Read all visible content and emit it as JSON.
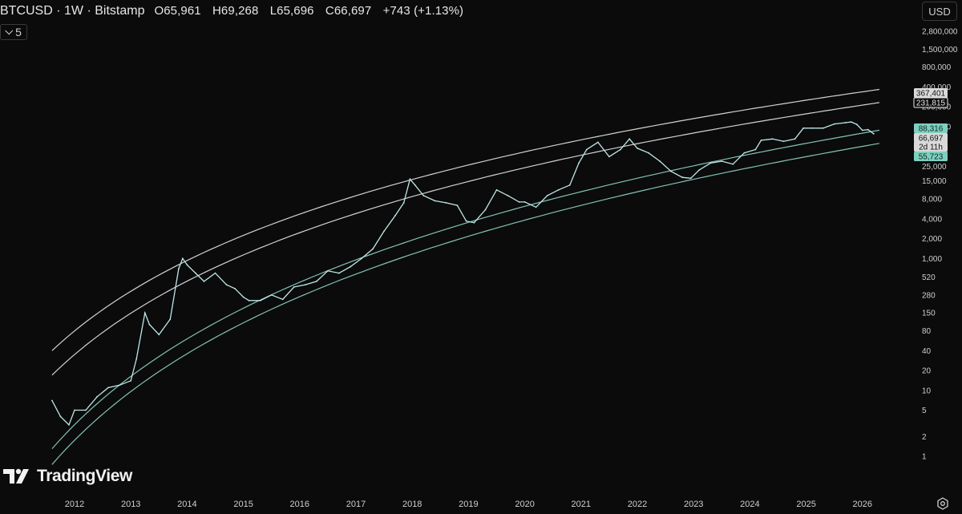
{
  "header": {
    "symbol": "BTCUSD · 1W · Bitstamp",
    "open": "O65,961",
    "high": "H69,268",
    "low": "L65,696",
    "close": "C66,697",
    "change": "+743 (+1.13%)"
  },
  "indicator_toggle": {
    "icon": "chevron-down-icon",
    "count": "5"
  },
  "currency_button": "USD",
  "logo_text": "TradingView",
  "colors": {
    "background": "#0b0b0b",
    "price": "#bfe6e6",
    "white_band": "#e8e8e8",
    "teal_band": "#8fd6c9",
    "tag_grey": "#d9d9d9",
    "tag_teal": "#7fcfbf"
  },
  "chart_data": {
    "type": "line",
    "title": "",
    "scale": "log",
    "x_ticks": [
      "2012",
      "2013",
      "2014",
      "2015",
      "2016",
      "2017",
      "2018",
      "2019",
      "2020",
      "2021",
      "2022",
      "2023",
      "2024",
      "2025",
      "2026"
    ],
    "y_ticks": [
      "2,800,000",
      "1,500,000",
      "800,000",
      "400,000",
      "200,000",
      "100,000",
      "50,000",
      "25,000",
      "15,000",
      "8,000",
      "4,000",
      "2,000",
      "1,000",
      "520",
      "280",
      "150",
      "80",
      "40",
      "20",
      "10",
      "5",
      "2",
      "1"
    ],
    "price_series": {
      "name": "BTCUSD weekly close",
      "x": [
        2011.6,
        2011.75,
        2011.9,
        2012.0,
        2012.2,
        2012.4,
        2012.6,
        2012.8,
        2013.0,
        2013.1,
        2013.25,
        2013.33,
        2013.5,
        2013.7,
        2013.85,
        2013.92,
        2014.0,
        2014.15,
        2014.3,
        2014.5,
        2014.7,
        2014.85,
        2015.0,
        2015.1,
        2015.3,
        2015.5,
        2015.7,
        2015.9,
        2016.1,
        2016.3,
        2016.5,
        2016.7,
        2016.9,
        2017.1,
        2017.3,
        2017.5,
        2017.7,
        2017.85,
        2017.96,
        2018.05,
        2018.2,
        2018.4,
        2018.6,
        2018.8,
        2018.96,
        2019.1,
        2019.3,
        2019.5,
        2019.7,
        2019.9,
        2020.0,
        2020.2,
        2020.4,
        2020.6,
        2020.8,
        2020.96,
        2021.1,
        2021.3,
        2021.5,
        2021.7,
        2021.86,
        2022.0,
        2022.2,
        2022.4,
        2022.6,
        2022.8,
        2022.95,
        2023.1,
        2023.3,
        2023.5,
        2023.7,
        2023.9,
        2024.1,
        2024.2,
        2024.4,
        2024.6,
        2024.8,
        2024.95,
        2025.1,
        2025.3,
        2025.5,
        2025.7,
        2025.8,
        2025.9,
        2026.0,
        2026.1,
        2026.2
      ],
      "y": [
        7,
        4,
        3,
        5,
        5,
        8,
        11,
        12,
        14,
        30,
        150,
        100,
        70,
        120,
        700,
        1000,
        800,
        600,
        450,
        600,
        400,
        350,
        260,
        230,
        230,
        280,
        240,
        370,
        400,
        450,
        650,
        600,
        750,
        1000,
        1400,
        2600,
        4500,
        7000,
        16000,
        13000,
        9000,
        7500,
        7000,
        6400,
        3700,
        3500,
        5500,
        11000,
        9000,
        7200,
        7200,
        6000,
        9000,
        11000,
        13000,
        28000,
        45000,
        58000,
        35000,
        45000,
        65000,
        47000,
        40000,
        30000,
        21000,
        17000,
        16500,
        22000,
        28000,
        30000,
        27000,
        40000,
        45000,
        62000,
        65000,
        60000,
        65000,
        95000,
        95000,
        95000,
        110000,
        115000,
        118000,
        108000,
        88000,
        90000,
        78000,
        66697
      ]
    },
    "bands": [
      {
        "name": "",
        "x": [
          2011.6,
          2026.3
        ],
        "y": [
          40,
          367401
        ]
      },
      {
        "name": "",
        "x": [
          2011.6,
          2026.3
        ],
        "y": [
          17,
          231815
        ]
      },
      {
        "name": "",
        "x": [
          2011.6,
          2026.3
        ],
        "y": [
          1.3,
          88316
        ]
      },
      {
        "name": "",
        "x": [
          2011.6,
          2026.3
        ],
        "y": [
          0.75,
          55723
        ]
      }
    ],
    "price_tags": [
      {
        "label": "367,401",
        "value": 367401,
        "style": "grey"
      },
      {
        "label": "231,815",
        "value": 231815,
        "style": "outline"
      },
      {
        "label": "88,316",
        "value": 88316,
        "style": "teal"
      },
      {
        "label": "66,697",
        "value": 66697,
        "style": "grey"
      },
      {
        "label": "2d 11h",
        "value": 51000,
        "style": "grey"
      },
      {
        "label": "55,723",
        "value": 40000,
        "style": "teal"
      }
    ]
  }
}
